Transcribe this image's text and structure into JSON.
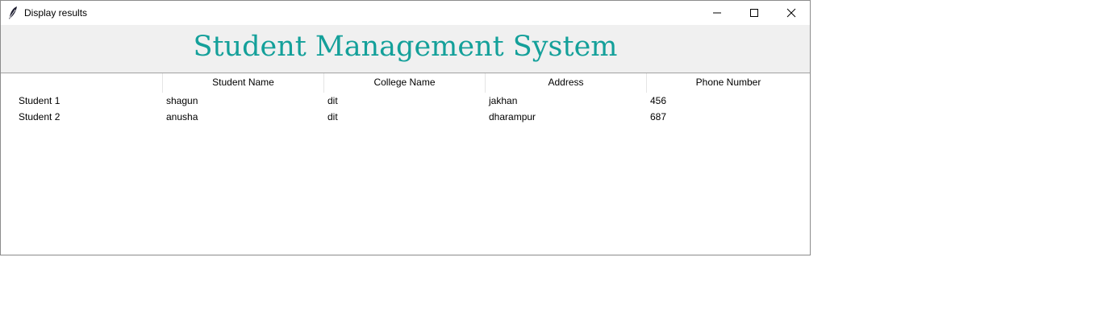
{
  "window": {
    "title": "Display results",
    "icon": "feather-icon",
    "controls": [
      "minimize-icon",
      "maximize-icon",
      "close-icon"
    ]
  },
  "app": {
    "title": "Student Management System",
    "title_color": "#14a09a",
    "band_color": "#f0f0f0"
  },
  "table": {
    "columns": [
      "",
      "Student Name",
      "College Name",
      "Address",
      "Phone Number"
    ],
    "rows": [
      {
        "id": "Student 1",
        "name": "shagun",
        "college": "dit",
        "address": "jakhan",
        "phone": "456"
      },
      {
        "id": "Student 2",
        "name": "anusha",
        "college": "dit",
        "address": "dharampur",
        "phone": "687"
      }
    ]
  }
}
